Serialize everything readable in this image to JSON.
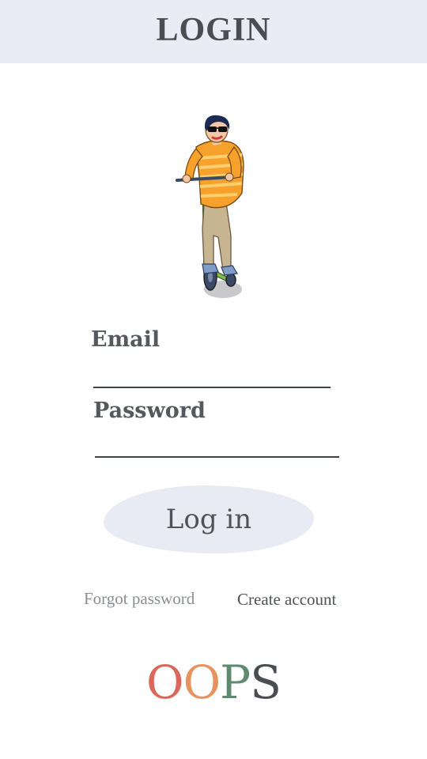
{
  "header": {
    "title": "LOGIN"
  },
  "form": {
    "email_label": "Email",
    "email_value": "",
    "password_label": "Password",
    "password_value": "",
    "login_button": "Log in"
  },
  "links": {
    "forgot_password": "Forgot password",
    "create_account": "Create account"
  },
  "logo": {
    "letters": [
      {
        "char": "O",
        "color": "#d9675a"
      },
      {
        "char": "O",
        "color": "#e6945f"
      },
      {
        "char": "P",
        "color": "#5e8a70"
      },
      {
        "char": "S",
        "color": "#4a4d52"
      }
    ]
  },
  "colors": {
    "header_bg": "#e9ecf4",
    "button_bg": "#e8ebf4",
    "text_dark": "#4a4d52",
    "text_muted": "#8b8e93"
  },
  "illustration": {
    "icon": "scooter-rider-illustration"
  }
}
